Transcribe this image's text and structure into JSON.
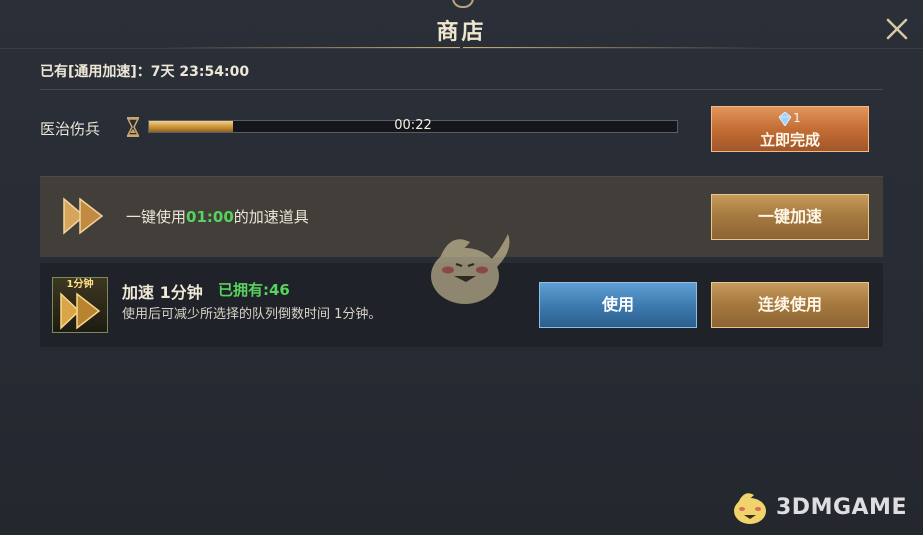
{
  "header": {
    "title": "商店"
  },
  "owned_line": {
    "text": "已有[通用加速]：7天 23:54:00"
  },
  "heal": {
    "label": "医治伤兵",
    "timer": "00:22",
    "progress_fraction": 0.16,
    "complete_button": {
      "gem_count": "1",
      "label": "立即完成"
    }
  },
  "speedup_all": {
    "prefix": "一键使用",
    "duration": "01:00",
    "suffix": "的加速道具",
    "button_label": "一键加速"
  },
  "item": {
    "badge": "1分钟",
    "name": "加速 1分钟",
    "owned": "已拥有:46",
    "description": "使用后可减少所选择的队列倒数时间 1分钟。",
    "use_label": "使用",
    "continuous_label": "连续使用"
  },
  "watermark": {
    "text": "3DMGAME"
  },
  "colors": {
    "highlight_green": "#56d35c",
    "gold": "#c9b07a",
    "background": "#262a33"
  },
  "icons": [
    "close-icon",
    "hourglass-icon",
    "gem-icon",
    "fast-forward-icon",
    "mascot-icon"
  ]
}
